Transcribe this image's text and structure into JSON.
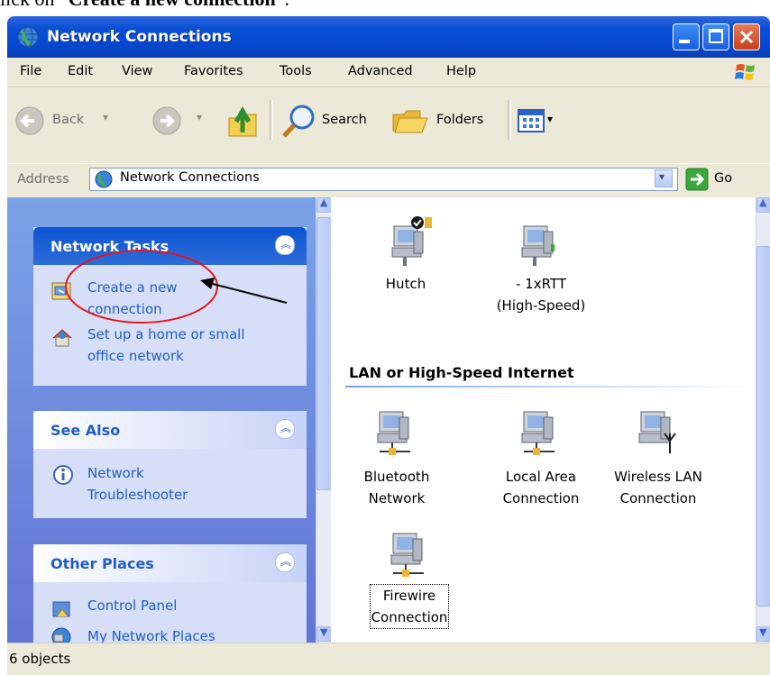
{
  "caption": {
    "prefix": "lick on “",
    "bold": "Create a new connection",
    "suffix": "”."
  },
  "window": {
    "title": "Network Connections"
  },
  "menu": [
    "File",
    "Edit",
    "View",
    "Favorites",
    "Tools",
    "Advanced",
    "Help"
  ],
  "toolbar": {
    "back": "Back",
    "search": "Search",
    "folders": "Folders"
  },
  "address": {
    "label": "Address",
    "value": "Network Connections",
    "go": "Go"
  },
  "sidebar": {
    "network_tasks": {
      "title": "Network Tasks",
      "items": [
        "Create a new\nconnection",
        "Set up a home or small\noffice network"
      ]
    },
    "see_also": {
      "title": "See Also",
      "items": [
        "Network\nTroubleshooter"
      ]
    },
    "other_places": {
      "title": "Other Places",
      "items": [
        "Control Panel",
        "My Network Places"
      ]
    }
  },
  "content": {
    "dialup": [
      {
        "label": "Hutch",
        "icon": "dialup-connection-icon"
      },
      {
        "label": "- 1xRTT\n(High-Speed)",
        "icon": "dialup-connection-icon"
      }
    ],
    "lan_header": "LAN or High-Speed Internet",
    "lan": [
      {
        "label": "Bluetooth\nNetwork",
        "icon": "lan-connection-icon"
      },
      {
        "label": "Local Area\nConnection",
        "icon": "lan-connection-icon"
      },
      {
        "label": "Wireless LAN\nConnection",
        "icon": "wireless-connection-icon"
      },
      {
        "label": "Firewire\nConnection",
        "icon": "lan-connection-icon"
      }
    ]
  },
  "status": {
    "text": "6 objects"
  },
  "colors": {
    "title_bar": "#0a4fd6",
    "link": "#215dc6",
    "sidebar": "#7ba2e7",
    "annotation": "#e8141c"
  }
}
